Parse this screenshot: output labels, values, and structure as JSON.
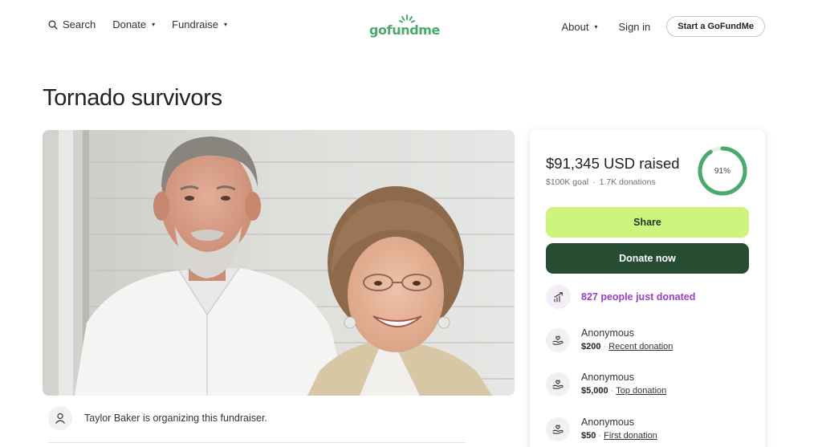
{
  "header": {
    "search_label": "Search",
    "donate_label": "Donate",
    "fundraise_label": "Fundraise",
    "logo_text": "gofundme",
    "about_label": "About",
    "signin_label": "Sign in",
    "start_label": "Start a GoFundMe",
    "caret_glyph": "▾",
    "brand_color": "#4aa96c"
  },
  "page": {
    "title": "Tornado survivors"
  },
  "organizer": {
    "text": "Taylor Baker is organizing this fundraiser."
  },
  "donation": {
    "raised_label": "$91,345 USD raised",
    "goal": "$100K goal",
    "separator": "·",
    "donations_count": "1.7K donations",
    "progress": 0.91,
    "progress_text": "91%",
    "share_label": "Share",
    "donate_label": "Donate now",
    "trend_text": "827 people just donated",
    "colors": {
      "ring": "#4aa96c",
      "share_bg": "#cdf57e",
      "donate_bg": "#264c32",
      "trend": "#9b3fc9"
    },
    "recent": [
      {
        "name": "Anonymous",
        "amount": "$200",
        "sep": "·",
        "tag": "Recent donation"
      },
      {
        "name": "Anonymous",
        "amount": "$5,000",
        "sep": "·",
        "tag": "Top donation"
      },
      {
        "name": "Anonymous",
        "amount": "$50",
        "sep": "·",
        "tag": "First donation"
      }
    ]
  }
}
